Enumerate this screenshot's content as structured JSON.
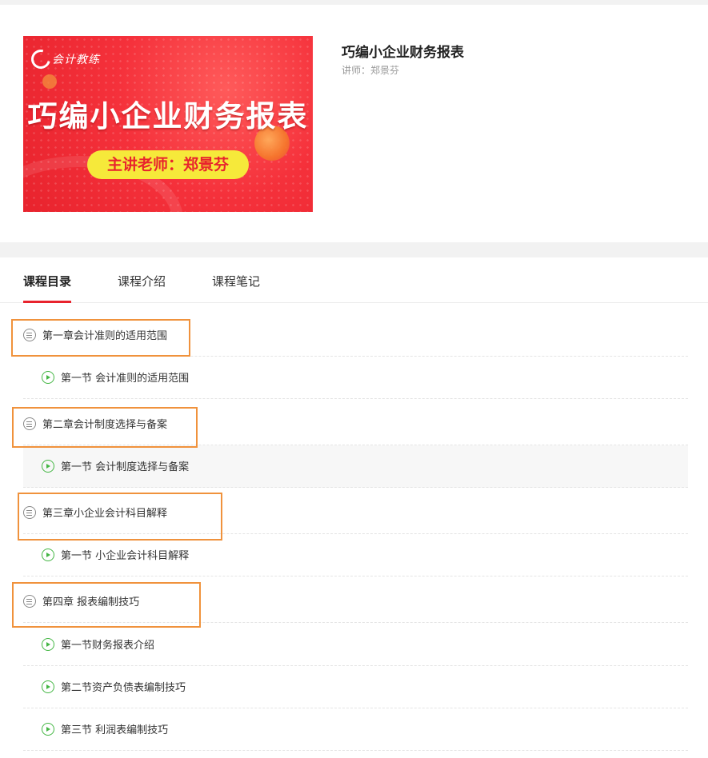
{
  "course": {
    "cover": {
      "logo_text": "会计教练",
      "title": "巧编小企业财务报表",
      "teacher_line": "主讲老师：郑景芬"
    },
    "title": "巧编小企业财务报表",
    "teacher": "讲师：郑景芬"
  },
  "tabs": [
    {
      "label": "课程目录",
      "active": true
    },
    {
      "label": "课程介绍",
      "active": false
    },
    {
      "label": "课程笔记",
      "active": false
    }
  ],
  "catalog": {
    "rows": [
      {
        "type": "chapter",
        "label": "第一章会计准则的适用范围"
      },
      {
        "type": "lesson",
        "label": "第一节 会计准则的适用范围"
      },
      {
        "type": "chapter",
        "label": "第二章会计制度选择与备案"
      },
      {
        "type": "lesson",
        "label": "第一节 会计制度选择与备案"
      },
      {
        "type": "chapter",
        "label": "第三章小企业会计科目解释"
      },
      {
        "type": "lesson",
        "label": "第一节 小企业会计科目解释"
      },
      {
        "type": "chapter",
        "label": "第四章 报表编制技巧"
      },
      {
        "type": "lesson",
        "label": "第一节财务报表介绍"
      },
      {
        "type": "lesson",
        "label": "第二节资产负债表编制技巧"
      },
      {
        "type": "lesson",
        "label": "第三节 利润表编制技巧"
      }
    ]
  },
  "colors": {
    "accent_red": "#e8232d",
    "highlight_box": "#f0923c",
    "play_green": "#43b643",
    "pill_yellow": "#f6e93a"
  },
  "icons": {
    "chapter": "list-circle-icon",
    "lesson": "play-circle-icon"
  }
}
